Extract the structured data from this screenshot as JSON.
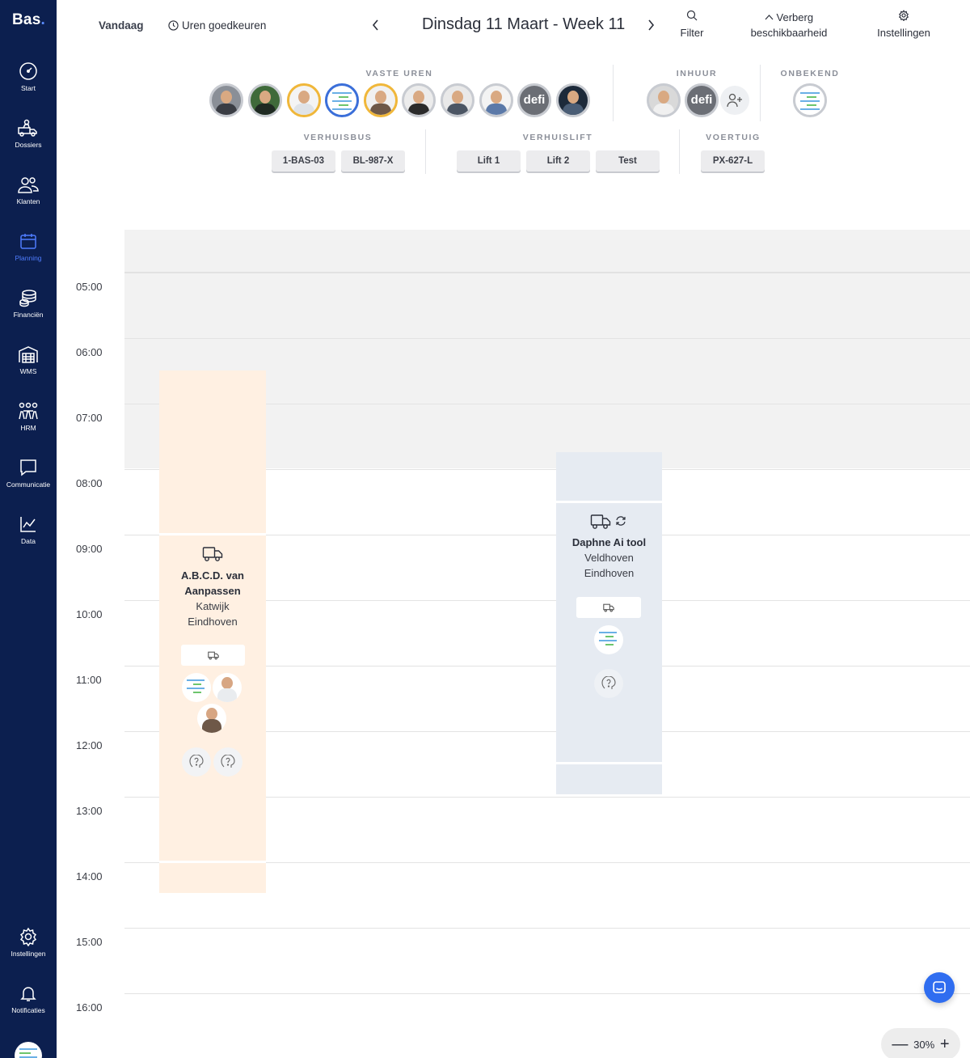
{
  "sidebar": {
    "logo": "Bas",
    "items": [
      {
        "label": "Start",
        "icon": "gauge-icon"
      },
      {
        "label": "Dossiers",
        "icon": "truck-person-icon"
      },
      {
        "label": "Klanten",
        "icon": "users-icon"
      },
      {
        "label": "Planning",
        "icon": "calendar-icon",
        "active": true
      },
      {
        "label": "Financiën",
        "icon": "coins-icon"
      },
      {
        "label": "WMS",
        "icon": "warehouse-icon"
      },
      {
        "label": "HRM",
        "icon": "people-group-icon"
      },
      {
        "label": "Communicatie",
        "icon": "chat-icon"
      },
      {
        "label": "Data",
        "icon": "chart-line-icon"
      }
    ],
    "bottom": [
      {
        "label": "Instellingen",
        "icon": "gear-icon"
      },
      {
        "label": "Notificaties",
        "icon": "bell-icon"
      }
    ]
  },
  "topbar": {
    "today": "Vandaag",
    "approve_hours": "Uren goedkeuren",
    "date_title": "Dinsdag 11 Maart - Week 11",
    "filter": "Filter",
    "hide_line1": "Verberg",
    "hide_line2": "beschikbaarheid",
    "settings": "Instellingen"
  },
  "resources": {
    "fixed_label": "VASTE UREN",
    "hire_label": "INHUUR",
    "unknown_label": "ONBEKEND",
    "defi_text": "defi",
    "bus_label": "VERHUISBUS",
    "lift_label": "VERHUISLIFT",
    "vehicle_label": "VOERTUIG",
    "buses": [
      "1-BAS-03",
      "BL-987-X"
    ],
    "lifts": [
      "Lift 1",
      "Lift 2",
      "Test"
    ],
    "vehicles": [
      "PX-627-L"
    ]
  },
  "calendar": {
    "hours": [
      "05:00",
      "06:00",
      "07:00",
      "08:00",
      "09:00",
      "10:00",
      "11:00",
      "12:00",
      "13:00",
      "14:00",
      "15:00",
      "16:00"
    ],
    "events": [
      {
        "title_line1": "A.B.C.D. van",
        "title_line2": "Aanpassen",
        "from": "Katwijk",
        "to": "Eindhoven",
        "color": "#fff0e2"
      },
      {
        "title_line1": "Daphne Ai tool",
        "from": "Veldhoven",
        "to": "Eindhoven",
        "color": "#e6ebf2"
      }
    ]
  },
  "zoom": {
    "level": "30%",
    "minus": "—",
    "plus": "+"
  },
  "colors": {
    "sidebar": "#0c1f4f",
    "accent": "#2f6df0",
    "gold_ring": "#f0b73a"
  }
}
